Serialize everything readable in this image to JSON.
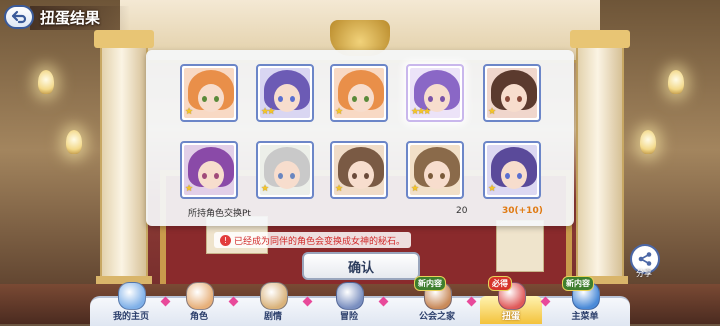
{
  "header": {
    "title": "扭蛋结果",
    "back_icon": "back-arrow-icon"
  },
  "results": {
    "cards": [
      {
        "name": "character-card-1",
        "stars": "★",
        "hair": "#e98f49",
        "eyes": "#5a8a3a",
        "bg": "#f8d9c4",
        "rare": false
      },
      {
        "name": "character-card-2",
        "stars": "★★",
        "hair": "#6c5bb5",
        "eyes": "#5a6fd0",
        "bg": "#d9d6f2",
        "rare": false
      },
      {
        "name": "character-card-3",
        "stars": "★",
        "hair": "#e98f49",
        "eyes": "#5a8a3a",
        "bg": "#f8d9c4",
        "rare": false
      },
      {
        "name": "character-card-4",
        "stars": "★★★",
        "hair": "#8a67c6",
        "eyes": "#7b52a8",
        "bg": "#ece3f8",
        "rare": true
      },
      {
        "name": "character-card-5",
        "stars": "★",
        "hair": "#5b3a2e",
        "eyes": "#8a4a3a",
        "bg": "#f0d6cc",
        "rare": false
      },
      {
        "name": "character-card-6",
        "stars": "★",
        "hair": "#8a4aa8",
        "eyes": "#a04a7a",
        "bg": "#e2cfe8",
        "rare": false
      },
      {
        "name": "character-card-7",
        "stars": "★",
        "hair": "#c9c9c9",
        "eyes": "#6a86c0",
        "bg": "#ecefe9",
        "rare": false
      },
      {
        "name": "character-card-8",
        "stars": "★",
        "hair": "#7a5a44",
        "eyes": "#6a4a3a",
        "bg": "#f0dcc8",
        "rare": false
      },
      {
        "name": "character-card-9",
        "stars": "★",
        "hair": "#8a6a4a",
        "eyes": "#7a5a3a",
        "bg": "#f2e0c8",
        "rare": false
      },
      {
        "name": "character-card-10",
        "stars": "★",
        "hair": "#5a4a9a",
        "eyes": "#5a6fd0",
        "bg": "#dcd8f2",
        "rare": false
      }
    ],
    "pt_label": "所持角色交换Pt",
    "pt_value": "20",
    "pt_new": "30(+10)"
  },
  "message": {
    "text": "已经成为同伴的角色会变换成女神的秘石。",
    "icon": "warning-icon"
  },
  "confirm_label": "确认",
  "share": {
    "label": "分享",
    "icon": "share-icon"
  },
  "nav": [
    {
      "label": "我的主页",
      "badge": "",
      "icon": "home-castle-icon",
      "color": "#7fb0e8"
    },
    {
      "label": "角色",
      "badge": "",
      "icon": "character-icon",
      "color": "#e7b07a"
    },
    {
      "label": "剧情",
      "badge": "",
      "icon": "story-scroll-icon",
      "color": "#d9b27a"
    },
    {
      "label": "冒险",
      "badge": "",
      "icon": "sword-icon",
      "color": "#7a8fc0"
    },
    {
      "label": "公会之家",
      "badge": "新内容",
      "icon": "guild-house-icon",
      "color": "#c98a5a"
    },
    {
      "label": "扭蛋",
      "badge": "必得",
      "icon": "gacha-icon",
      "color": "#e05a5a"
    },
    {
      "label": "主菜单",
      "badge": "新内容",
      "icon": "crystal-menu-icon",
      "color": "#4a8ad8"
    }
  ]
}
